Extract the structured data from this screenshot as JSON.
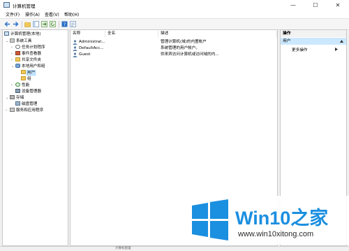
{
  "window": {
    "title": "计算机管理",
    "controls": {
      "minimize": "—",
      "maximize": "☐",
      "close": "✕"
    }
  },
  "menu": [
    "文件(F)",
    "操作(A)",
    "查看(V)",
    "帮助(H)"
  ],
  "tree": {
    "root": "计算机管理(本地)",
    "system_tools": "系统工具",
    "task_scheduler": "任务计划程序",
    "event_viewer": "事件查看器",
    "shared_folders": "共享文件夹",
    "local_users_groups": "本地用户和组",
    "users": "用户",
    "groups": "组",
    "performance": "性能",
    "device_manager": "设备管理器",
    "storage": "存储",
    "disk_management": "磁盘管理",
    "services_apps": "服务和应用程序"
  },
  "list": {
    "columns": {
      "name": "名称",
      "fullname": "全名",
      "description": "描述"
    },
    "rows": [
      {
        "name": "Administrat...",
        "fullname": "",
        "description": "管理计算机(域)的内置帐户"
      },
      {
        "name": "DefaultAcc...",
        "fullname": "",
        "description": "系统管理的用户帐户。"
      },
      {
        "name": "Guest",
        "fullname": "",
        "description": "供来宾访问计算机或访问域的内..."
      }
    ]
  },
  "actions": {
    "header": "操作",
    "section": "用户",
    "more": "更多操作"
  },
  "statusbar": {
    "text": "计算机管理"
  },
  "watermark": {
    "brand_a": "Win10",
    "brand_b": "之家",
    "url": "www.win10xitong.com",
    "color": "#1b8fe0"
  }
}
